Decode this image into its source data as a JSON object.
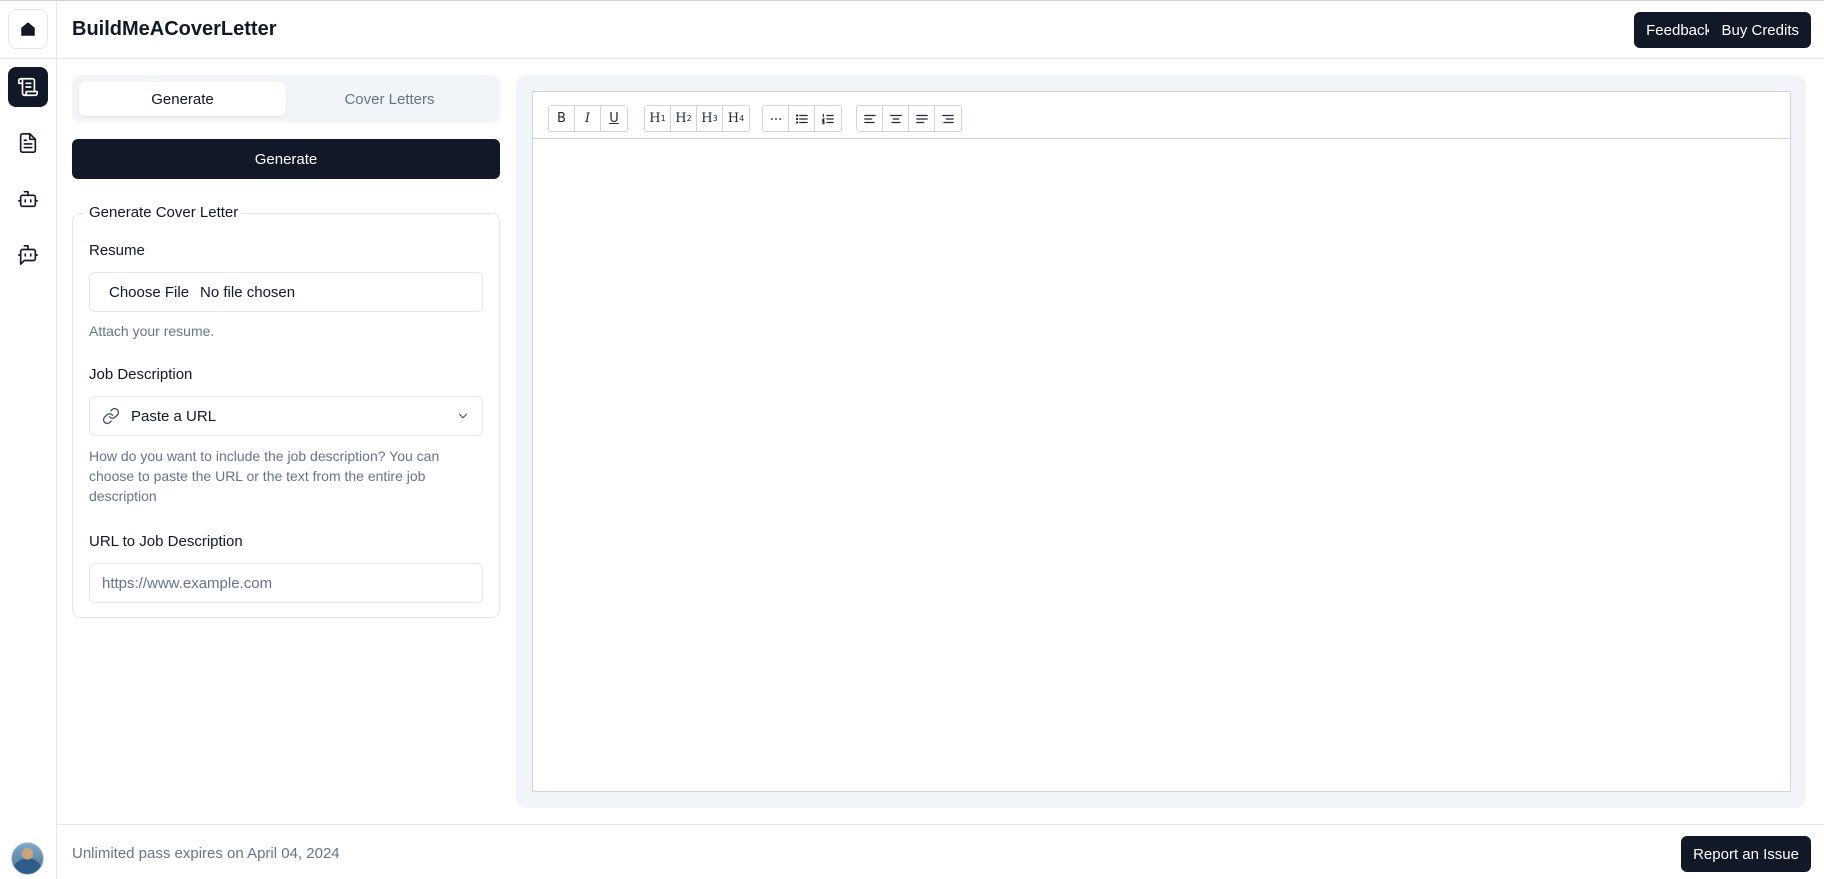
{
  "app": {
    "title": "BuildMeACoverLetter"
  },
  "header": {
    "feedback_label": "Feedback",
    "buy_credits_label": "Buy Credits"
  },
  "sidebar": {
    "items": [
      {
        "name": "home-icon"
      },
      {
        "name": "scroll-icon",
        "active": true
      },
      {
        "name": "document-icon"
      },
      {
        "name": "bot-icon"
      },
      {
        "name": "bot-message-icon"
      }
    ]
  },
  "tabs": [
    {
      "label": "Generate",
      "active": true
    },
    {
      "label": "Cover Letters",
      "active": false
    }
  ],
  "generate_button": "Generate",
  "form": {
    "legend": "Generate Cover Letter",
    "resume": {
      "label": "Resume",
      "button": "Choose File",
      "status": "No file chosen",
      "help": "Attach your resume."
    },
    "job_description": {
      "label": "Job Description",
      "selected": "Paste a URL",
      "help": "How do you want to include the job description? You can choose to paste the URL or the text from the entire job description"
    },
    "url": {
      "label": "URL to Job Description",
      "placeholder": "https://www.example.com",
      "value": ""
    }
  },
  "editor": {
    "toolbar": {
      "bold": "B",
      "italic": "I",
      "underline": "U",
      "h1": "H",
      "h2": "H",
      "h3": "H",
      "h4": "H",
      "h1_level": "1",
      "h2_level": "2",
      "h3_level": "3",
      "h4_level": "4"
    },
    "content": ""
  },
  "footer": {
    "pass_text": "Unlimited pass expires on April 04, 2024",
    "report_label": "Report an Issue"
  },
  "colors": {
    "primary": "#111827",
    "muted_text": "#64748b",
    "panel_bg": "#f1f5f9",
    "border": "#e5e7eb"
  }
}
